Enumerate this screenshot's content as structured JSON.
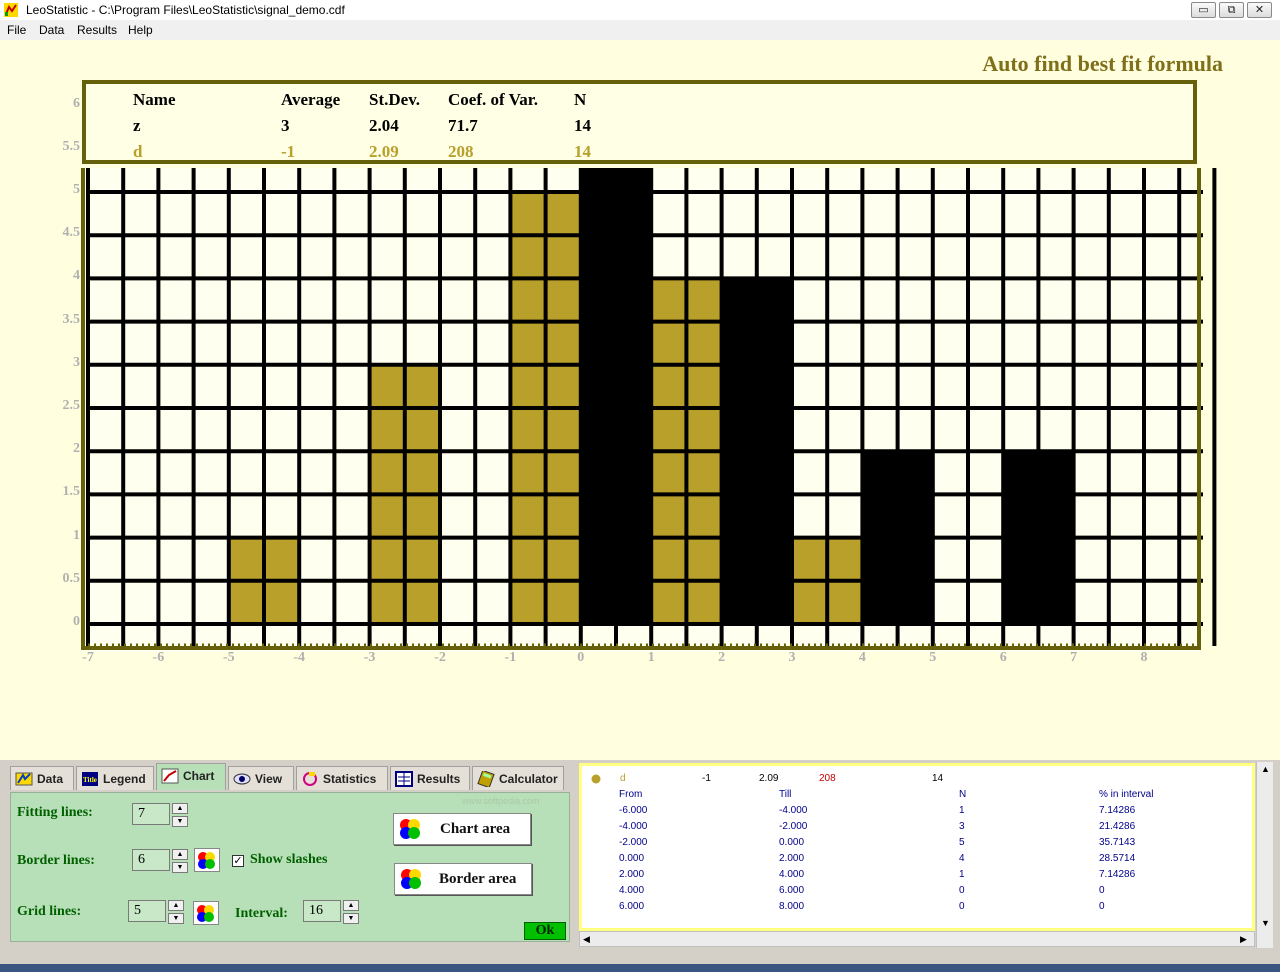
{
  "window": {
    "title": "LeoStatistic - C:\\Program Files\\LeoStatistic\\signal_demo.cdf",
    "minimize_glyph": "▭",
    "restore_glyph": "⧉",
    "close_glyph": "✕"
  },
  "menu": [
    "File",
    "Data",
    "Results",
    "Help"
  ],
  "header_title": "Auto find best fit formula",
  "stats": {
    "headers": [
      "Name",
      "Average",
      "St.Dev.",
      "Coef. of Var.",
      "N"
    ],
    "rows": [
      {
        "name": "z",
        "average": "3",
        "stdev": "2.04",
        "cov": "71.7",
        "n": "14"
      },
      {
        "name": "d",
        "average": "-1",
        "stdev": "2.09",
        "cov": "208",
        "n": "14"
      }
    ]
  },
  "chart_data": {
    "type": "bar",
    "xlim": [
      -7,
      9
    ],
    "ylim": [
      0,
      6
    ],
    "x_ticks": [
      "-7",
      "-6",
      "-5",
      "-4",
      "-3",
      "-2",
      "-1",
      "0",
      "1",
      "2",
      "3",
      "4",
      "5",
      "6",
      "7",
      "8"
    ],
    "y_ticks": [
      "0",
      "0.5",
      "1",
      "1.5",
      "2",
      "2.5",
      "3",
      "3.5",
      "4",
      "4.5",
      "5",
      "5.5",
      "6"
    ],
    "grid": true,
    "series": [
      {
        "name": "d",
        "color": "#b8a02a",
        "bars": [
          {
            "from": -5,
            "till": -4,
            "value": 1
          },
          {
            "from": -3,
            "till": -2,
            "value": 3
          },
          {
            "from": -1,
            "till": 0,
            "value": 5
          },
          {
            "from": 1,
            "till": 2,
            "value": 4
          },
          {
            "from": 3,
            "till": 4,
            "value": 1
          }
        ]
      },
      {
        "name": "z",
        "color": "#000000",
        "bars": [
          {
            "from": 0,
            "till": 1,
            "value": 6
          },
          {
            "from": 2,
            "till": 3,
            "value": 4
          },
          {
            "from": 4,
            "till": 5,
            "value": 2
          },
          {
            "from": 6,
            "till": 7,
            "value": 2
          }
        ]
      }
    ]
  },
  "tabs": [
    {
      "label": "Data",
      "icon": "data-icon"
    },
    {
      "label": "Legend",
      "icon": "legend-icon"
    },
    {
      "label": "Chart",
      "icon": "chart-icon"
    },
    {
      "label": "View",
      "icon": "eye-icon"
    },
    {
      "label": "Statistics",
      "icon": "statistics-icon"
    },
    {
      "label": "Results",
      "icon": "results-icon"
    },
    {
      "label": "Calculator",
      "icon": "calculator-icon"
    }
  ],
  "tab_icon_text": "Title",
  "chart_panel": {
    "fitting_lines_label": "Fitting lines:",
    "fitting_lines_value": "7",
    "border_lines_label": "Border lines:",
    "border_lines_value": "6",
    "show_slashes_label": "Show slashes",
    "show_slashes_mark": "✓",
    "grid_lines_label": "Grid lines:",
    "grid_lines_value": "5",
    "interval_label": "Interval:",
    "interval_value": "16",
    "chart_area_label": "Chart area",
    "border_area_label": "Border area",
    "ok_label": "Ok",
    "spin_up": "▲",
    "spin_down": "▼"
  },
  "watermark": "www.softpedia.com",
  "results_panel": {
    "summary": {
      "name": "d",
      "average": "-1",
      "stdev": "2.09",
      "cov": "208",
      "n": "14"
    },
    "headers": [
      "From",
      "Till",
      "N",
      "% in interval"
    ],
    "rows": [
      [
        "-6.000",
        "-4.000",
        "1",
        "7.14286"
      ],
      [
        "-4.000",
        "-2.000",
        "3",
        "21.4286"
      ],
      [
        "-2.000",
        "0.000",
        "5",
        "35.7143"
      ],
      [
        "0.000",
        "2.000",
        "4",
        "28.5714"
      ],
      [
        "2.000",
        "4.000",
        "1",
        "7.14286"
      ],
      [
        "4.000",
        "6.000",
        "0",
        "0"
      ],
      [
        "6.000",
        "8.000",
        "0",
        "0"
      ]
    ],
    "scroll_up": "▲",
    "scroll_down": "▼",
    "scroll_left": "◀",
    "scroll_right": "▶"
  }
}
